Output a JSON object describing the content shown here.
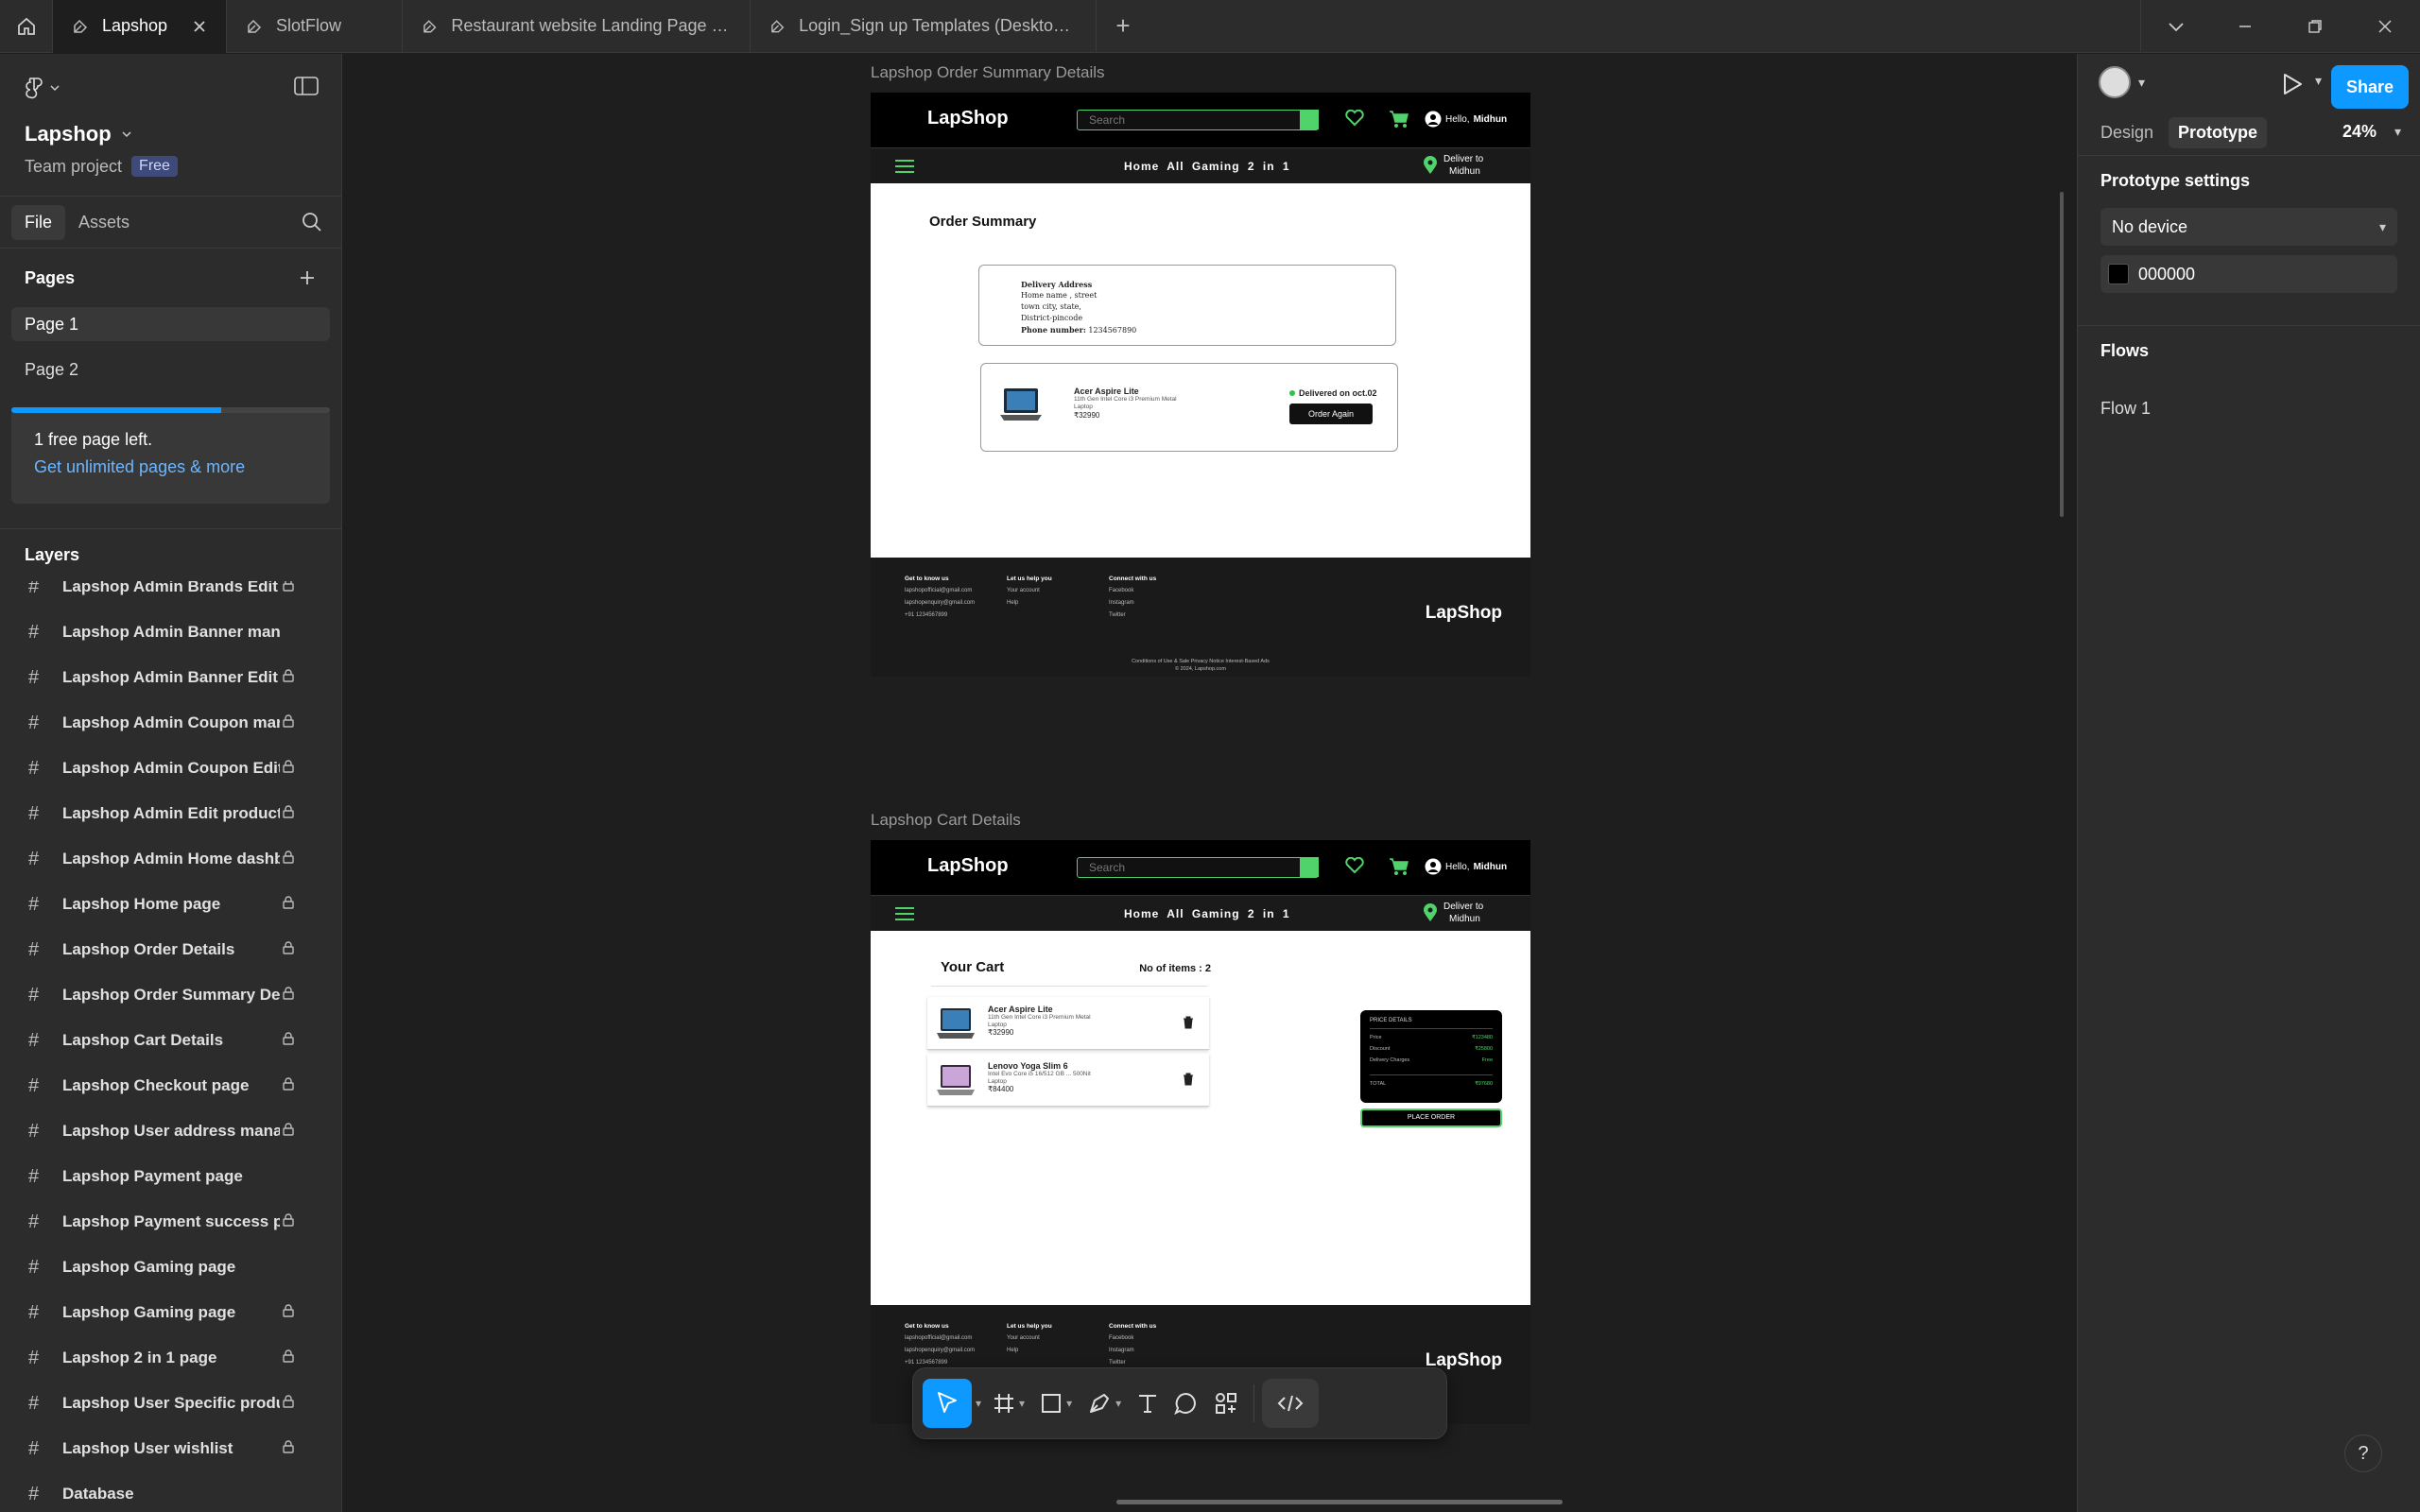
{
  "tabs": [
    {
      "label": "Lapshop",
      "active": true
    },
    {
      "label": "SlotFlow"
    },
    {
      "label": "Restaurant website Landing Page Des"
    },
    {
      "label": "Login_Sign up Templates (Desktop) (C"
    }
  ],
  "left": {
    "project_name": "Lapshop",
    "project_scope": "Team project",
    "plan_badge": "Free",
    "file_tab": "File",
    "assets_tab": "Assets",
    "pages_heading": "Pages",
    "pages": [
      "Page 1",
      "Page 2"
    ],
    "pages_used_fraction": 0.66,
    "upgrade_line1": "1 free page left.",
    "upgrade_line2": "Get unlimited pages & more",
    "layers_heading": "Layers",
    "layers": [
      {
        "name": "Lapshop Admin Brands Edit |",
        "locked": true
      },
      {
        "name": "Lapshop Admin Banner management",
        "locked": false
      },
      {
        "name": "Lapshop Admin Banner Edit |",
        "locked": true
      },
      {
        "name": "Lapshop Admin Coupon mar",
        "locked": true
      },
      {
        "name": "Lapshop Admin Coupon Edit",
        "locked": true
      },
      {
        "name": "Lapshop Admin Edit  product",
        "locked": true
      },
      {
        "name": "Lapshop Admin Home dashb",
        "locked": true
      },
      {
        "name": "Lapshop Home page",
        "locked": true
      },
      {
        "name": "Lapshop Order Details",
        "locked": true
      },
      {
        "name": "Lapshop Order Summary De",
        "locked": true
      },
      {
        "name": "Lapshop Cart Details",
        "locked": true
      },
      {
        "name": "Lapshop Checkout page",
        "locked": true
      },
      {
        "name": "Lapshop User address mana",
        "locked": true
      },
      {
        "name": "Lapshop Payment page",
        "locked": false
      },
      {
        "name": "Lapshop Payment success p",
        "locked": true
      },
      {
        "name": "Lapshop Gaming page",
        "locked": false
      },
      {
        "name": "Lapshop Gaming page",
        "locked": true
      },
      {
        "name": "Lapshop 2 in 1 page",
        "locked": true
      },
      {
        "name": "Lapshop User Specific produ",
        "locked": true
      },
      {
        "name": "Lapshop User wishlist",
        "locked": true
      },
      {
        "name": "Database",
        "locked": false
      }
    ]
  },
  "canvas": {
    "frame1_label": "Lapshop Order Summary Details",
    "frame2_label": "Lapshop Cart Details",
    "site": {
      "logo": "LapShop",
      "search_placeholder": "Search",
      "greeting_prefix": "Hello,",
      "greeting_name": "Midhun",
      "nav_links": "Home  All  Gaming  2 in 1",
      "deliver_to": "Deliver to",
      "deliver_name": "Midhun",
      "footer": {
        "col1_head": "Get to know us",
        "col1_items": [
          "lapshopofficial@gmail.com",
          "lapshopenquiry@gmail.com",
          "+91 1234567899"
        ],
        "col2_head": "Let us help you",
        "col2_items": [
          "Your account",
          "Help"
        ],
        "col3_head": "Connect with us",
        "col3_items": [
          "Facebook",
          "Instagram",
          "Twitter"
        ],
        "copy1": "Conditions of Use & Sale  Privacy Notice  Interest-Based Ads",
        "copy2": "© 2024, Lapshop.com"
      }
    },
    "order_summary": {
      "title": "Order Summary",
      "address_head": "Delivery Address",
      "address_lines": [
        "Home name , street",
        "town city, state,",
        "District-pincode"
      ],
      "phone_label": "Phone number:",
      "phone": "1234567890",
      "product_name": "Acer Aspire Lite",
      "product_desc": "11th Gen Intel Core i3 Premium Metal Laptop",
      "product_price": "₹32990",
      "status": "Delivered on oct.02",
      "order_again": "Order Again"
    },
    "cart": {
      "title": "Your Cart",
      "count": "No of items : 2",
      "items": [
        {
          "name": "Acer Aspire Lite",
          "desc": "11th Gen Intel Core i3 Premium Metal Laptop",
          "price": "₹32990"
        },
        {
          "name": "Lenovo Yoga Slim 6",
          "desc": "Intel Evo Core i5 16/512 GB ... 500Nit Laptop",
          "price": "₹84400"
        }
      ],
      "price_head": "PRICE DETAILS",
      "price_rows": [
        {
          "label": "Price",
          "value": "₹123480"
        },
        {
          "label": "Discount",
          "value": "₹25800"
        },
        {
          "label": "Delivery Charges",
          "value": "Free"
        }
      ],
      "total_label": "TOTAL",
      "total_value": "₹97680",
      "place_order": "PLACE ORDER"
    }
  },
  "right": {
    "design_tab": "Design",
    "prototype_tab": "Prototype",
    "zoom": "24%",
    "share": "Share",
    "proto_heading": "Prototype settings",
    "device": "No device",
    "bg_color_hex": "000000",
    "flows_heading": "Flows",
    "flow_item": "Flow 1"
  },
  "help": "?"
}
